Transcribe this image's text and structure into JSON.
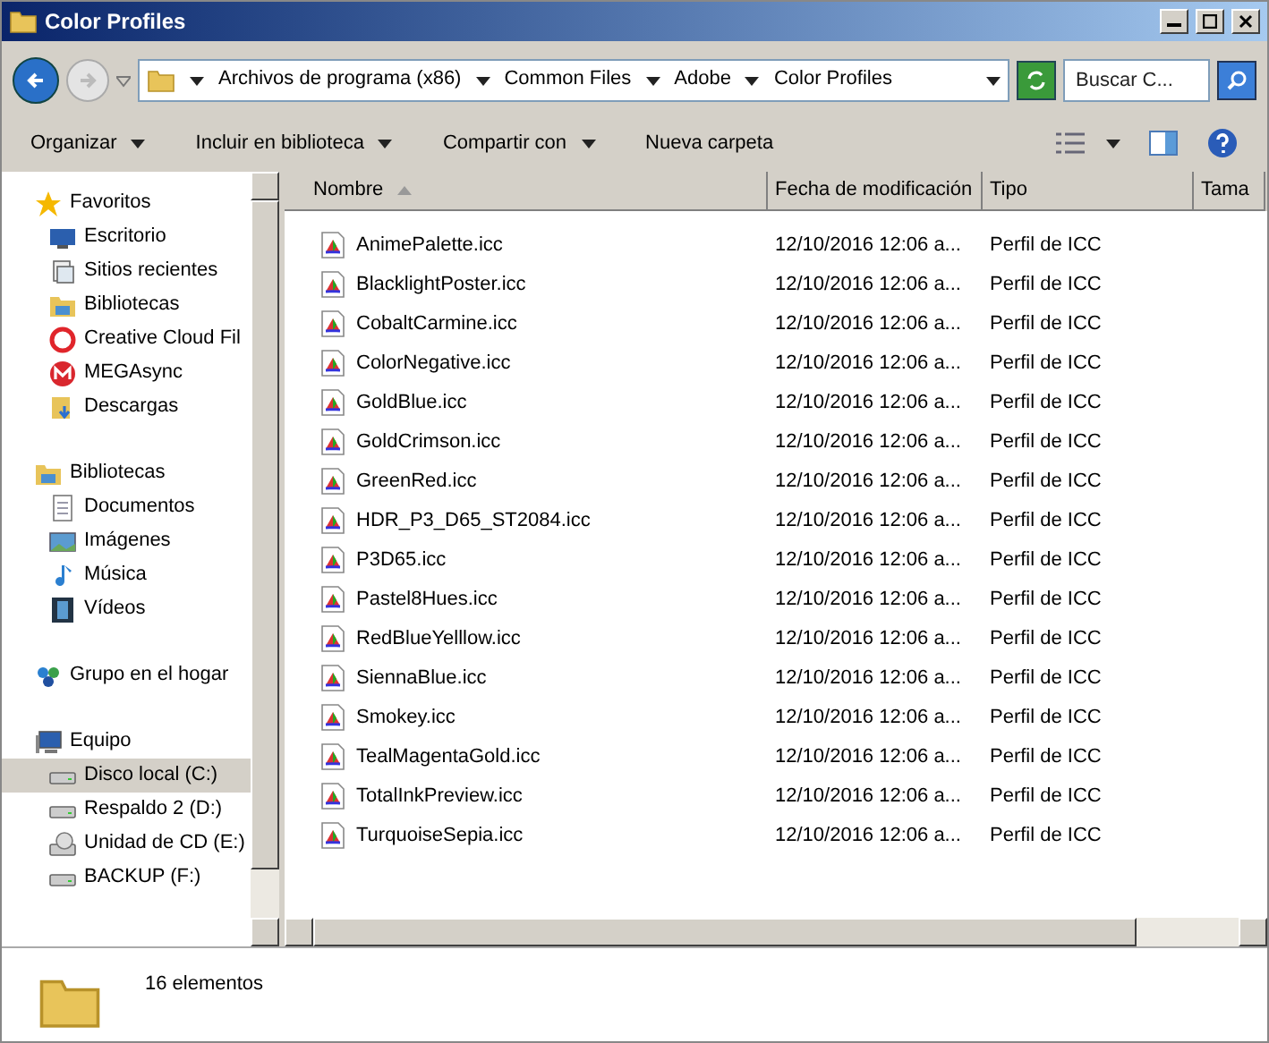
{
  "window": {
    "title": "Color Profiles"
  },
  "address": {
    "segments": [
      "Archivos de programa (x86)",
      "Common Files",
      "Adobe",
      "Color Profiles"
    ]
  },
  "search": {
    "placeholder": "Buscar C..."
  },
  "toolbar": [
    {
      "label": "Organizar",
      "dropdown": true
    },
    {
      "label": "Incluir en biblioteca",
      "dropdown": true
    },
    {
      "label": "Compartir con",
      "dropdown": true
    },
    {
      "label": "Nueva carpeta",
      "dropdown": false
    }
  ],
  "nav": [
    {
      "label": "Favoritos",
      "kind": "star",
      "selected": false,
      "children": [
        {
          "label": "Escritorio",
          "kind": "desktop",
          "selected": false
        },
        {
          "label": "Sitios recientes",
          "kind": "recent",
          "selected": false
        },
        {
          "label": "Bibliotecas",
          "kind": "library",
          "selected": false
        },
        {
          "label": "Creative Cloud Fil",
          "kind": "cloud",
          "selected": false
        },
        {
          "label": "MEGAsync",
          "kind": "mega",
          "selected": false
        },
        {
          "label": "Descargas",
          "kind": "download",
          "selected": false
        }
      ]
    },
    {
      "label": "Bibliotecas",
      "kind": "library",
      "selected": false,
      "children": [
        {
          "label": "Documentos",
          "kind": "doc",
          "selected": false
        },
        {
          "label": "Imágenes",
          "kind": "image",
          "selected": false
        },
        {
          "label": "Música",
          "kind": "music",
          "selected": false
        },
        {
          "label": "Vídeos",
          "kind": "video",
          "selected": false
        }
      ]
    },
    {
      "label": "Grupo en el hogar",
      "kind": "home",
      "selected": false
    },
    {
      "label": "Equipo",
      "kind": "computer",
      "selected": false,
      "children": [
        {
          "label": "Disco local (C:)",
          "kind": "drive",
          "selected": true
        },
        {
          "label": "Respaldo 2 (D:)",
          "kind": "drive",
          "selected": false
        },
        {
          "label": "Unidad de CD (E:)",
          "kind": "cd",
          "selected": false
        },
        {
          "label": "BACKUP (F:)",
          "kind": "drive",
          "selected": false
        }
      ]
    }
  ],
  "table": {
    "columns": [
      "Nombre",
      "Fecha de modificación",
      "Tipo",
      "Tama"
    ],
    "rows": [
      [
        "AnimePalette.icc",
        "12/10/2016 12:06 a...",
        "Perfil de ICC"
      ],
      [
        "BlacklightPoster.icc",
        "12/10/2016 12:06 a...",
        "Perfil de ICC"
      ],
      [
        "CobaltCarmine.icc",
        "12/10/2016 12:06 a...",
        "Perfil de ICC"
      ],
      [
        "ColorNegative.icc",
        "12/10/2016 12:06 a...",
        "Perfil de ICC"
      ],
      [
        "GoldBlue.icc",
        "12/10/2016 12:06 a...",
        "Perfil de ICC"
      ],
      [
        "GoldCrimson.icc",
        "12/10/2016 12:06 a...",
        "Perfil de ICC"
      ],
      [
        "GreenRed.icc",
        "12/10/2016 12:06 a...",
        "Perfil de ICC"
      ],
      [
        "HDR_P3_D65_ST2084.icc",
        "12/10/2016 12:06 a...",
        "Perfil de ICC"
      ],
      [
        "P3D65.icc",
        "12/10/2016 12:06 a...",
        "Perfil de ICC"
      ],
      [
        "Pastel8Hues.icc",
        "12/10/2016 12:06 a...",
        "Perfil de ICC"
      ],
      [
        "RedBlueYelllow.icc",
        "12/10/2016 12:06 a...",
        "Perfil de ICC"
      ],
      [
        "SiennaBlue.icc",
        "12/10/2016 12:06 a...",
        "Perfil de ICC"
      ],
      [
        "Smokey.icc",
        "12/10/2016 12:06 a...",
        "Perfil de ICC"
      ],
      [
        "TealMagentaGold.icc",
        "12/10/2016 12:06 a...",
        "Perfil de ICC"
      ],
      [
        "TotalInkPreview.icc",
        "12/10/2016 12:06 a...",
        "Perfil de ICC"
      ],
      [
        "TurquoiseSepia.icc",
        "12/10/2016 12:06 a...",
        "Perfil de ICC"
      ]
    ]
  },
  "status_bar": {
    "count": "16 elementos"
  }
}
